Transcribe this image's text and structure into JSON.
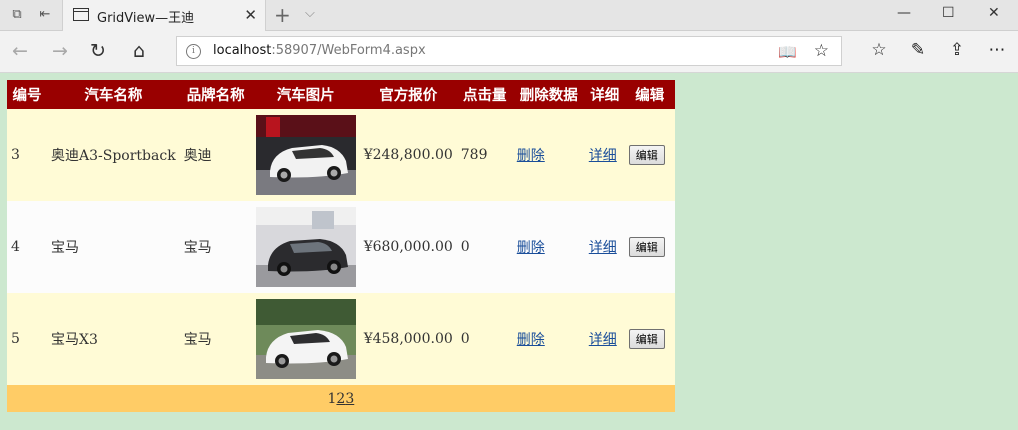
{
  "browser": {
    "tab_title": "GridView—王迪",
    "url_host": "localhost",
    "url_rest": ":58907/WebForm4.aspx"
  },
  "grid": {
    "headers": [
      "编号",
      "汽车名称",
      "品牌名称",
      "汽车图片",
      "官方报价",
      "点击量",
      "删除数据",
      "详细",
      "编辑"
    ],
    "rows": [
      {
        "id": "3",
        "name": "奥迪A3-Sportback",
        "brand": "奥迪",
        "price": "¥248,800.00",
        "clicks": "789",
        "delete": "删除",
        "detail": "详细",
        "edit": "编辑",
        "image": "white-audi-car-photo"
      },
      {
        "id": "4",
        "name": "宝马",
        "brand": "宝马",
        "price": "¥680,000.00",
        "clicks": "0",
        "delete": "删除",
        "detail": "详细",
        "edit": "编辑",
        "image": "dark-bmw-car-photo"
      },
      {
        "id": "5",
        "name": "宝马X3",
        "brand": "宝马",
        "price": "¥458,000.00",
        "clicks": "0",
        "delete": "删除",
        "detail": "详细",
        "edit": "编辑",
        "image": "white-bmw-car-photo"
      }
    ],
    "pager": {
      "current": "1",
      "pages": [
        "2",
        "3"
      ]
    }
  },
  "colors": {
    "header": "#990000",
    "odd_row": "#fffbd6",
    "pager": "#ffcc66",
    "page_bg": "#cce8cf"
  }
}
